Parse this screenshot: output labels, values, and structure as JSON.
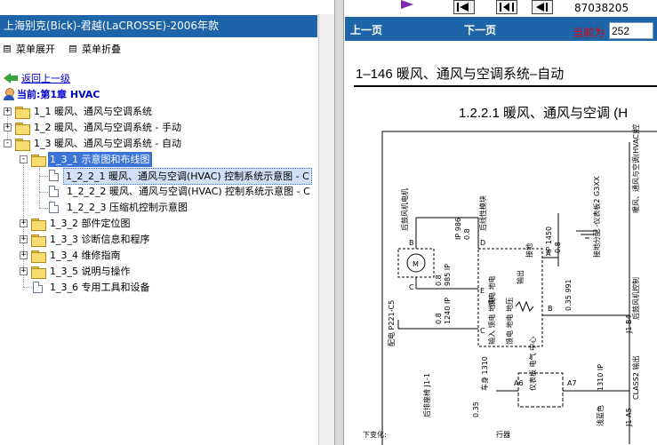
{
  "left_pane": {
    "title": "上海别克(Bick)-君越(LaCROSSE)-2006年款",
    "menu_expand": "菜单展开",
    "menu_collapse": "菜单折叠",
    "back_link": "返回上一级",
    "current": "当前:第1章 HVAC",
    "tree": [
      {
        "label": "1_1 暖风、通风与空调系统",
        "kind": "folder",
        "expander": "+"
      },
      {
        "label": "1_2 暖风、通风与空调系统 - 手动",
        "kind": "folder",
        "expander": "+"
      },
      {
        "label": "1_3 暖风、通风与空调系统 - 自动",
        "kind": "folder",
        "expander": "-"
      },
      {
        "label": "1_3_1 示意图和布线图",
        "kind": "folder-open",
        "expander": "-"
      },
      {
        "label": "1_2_2_1 暖风、通风与空调(HVAC) 控制系统示意图 - C",
        "kind": "doc"
      },
      {
        "label": "1_2_2_2 暖风、通风与空调(HVAC) 控制系统示意图 - C",
        "kind": "doc"
      },
      {
        "label": "1_2_2_3 压缩机控制示意图",
        "kind": "doc"
      },
      {
        "label": "1_3_2 部件定位图",
        "kind": "folder",
        "expander": "+"
      },
      {
        "label": "1_3_3 诊断信息和程序",
        "kind": "folder",
        "expander": "+"
      },
      {
        "label": "1_3_4 维修指南",
        "kind": "folder",
        "expander": "+"
      },
      {
        "label": "1_3_5 说明与操作",
        "kind": "folder",
        "expander": "+"
      },
      {
        "label": "1_3_6 专用工具和设备",
        "kind": "doc"
      }
    ]
  },
  "right_pane": {
    "phone": "87038205",
    "prev_page": "上一页",
    "next_page": "下一页",
    "current_page_label": "当前为",
    "current_page_value": "252",
    "doc_header": "1–146    暖风、通风与空调系统–自动",
    "doc_section": "1.2.2.1 暖风、通风与空调 (H",
    "diagram_labels": {
      "rear_blower": "后鼓风机电机",
      "rear_mode": "后线性模块",
      "m": "M",
      "pins": [
        "B",
        "D",
        "A",
        "C",
        "E",
        "A",
        "B",
        "C"
      ],
      "wire_ip_986": "IP 986",
      "wire_08": "0.8",
      "wire_ip_1450": "IP 1450",
      "wire_985": "985 IP",
      "wire_991": "0.35 991",
      "wire_1240": "1240 IP",
      "dist": "接地分配 -仪表板2 G3XX",
      "ground": "接地",
      "output": "输出",
      "feed": "馈电 地电",
      "feed2": "输入 馈电 地电",
      "feed3": "馈电 地电 地压",
      "hvac_title": "暖风、通风与空调(HVAC)控制总成",
      "rear_blower_ctrl": "后鼓风机控制",
      "j1_b4": "J1-B4",
      "p221": "配电 P221-C5",
      "rear_trans": "后排座椅 J1-1",
      "yibiao": "仪表板 电气 中心",
      "a6": "A6",
      "a7": "A7",
      "w1310": "车身 1310",
      "w035": "0.35",
      "w1310b": "1310 IP",
      "class2": "CLASS2 输出",
      "qianlan": "浅蓝色",
      "j1a5": "J1-A5",
      "bottom1": "下变化:",
      "bottom2": "行器"
    }
  },
  "colors": {
    "title_bar": "#1e64a8",
    "selection": "#3a74d8",
    "link": "#0000cc",
    "page_label": "#e00000"
  },
  "icons": [
    "menu-icon",
    "back-arrow-icon",
    "user-icon",
    "folder-icon",
    "folder-open-icon",
    "document-icon",
    "first-page-icon",
    "prev-page-icon",
    "next-page-icon",
    "bookmark-icon",
    "motor-icon",
    "ground-icon"
  ]
}
